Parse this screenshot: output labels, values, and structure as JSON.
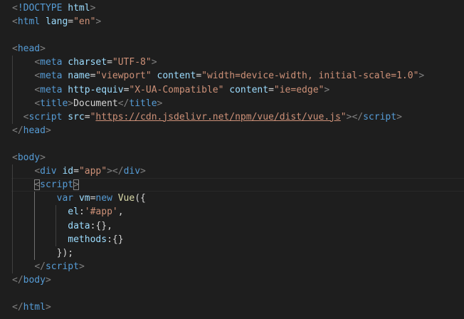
{
  "editor": {
    "lines": [
      [
        {
          "t": "<",
          "c": "punc"
        },
        {
          "t": "!DOCTYPE",
          "c": "tag"
        },
        {
          "t": " ",
          "c": "txt"
        },
        {
          "t": "html",
          "c": "attr"
        },
        {
          "t": ">",
          "c": "punc"
        }
      ],
      [
        {
          "t": "<",
          "c": "punc"
        },
        {
          "t": "html",
          "c": "tag"
        },
        {
          "t": " ",
          "c": "txt"
        },
        {
          "t": "lang",
          "c": "attr"
        },
        {
          "t": "=",
          "c": "txt"
        },
        {
          "t": "\"en\"",
          "c": "str"
        },
        {
          "t": ">",
          "c": "punc"
        }
      ],
      [],
      [
        {
          "t": "<",
          "c": "punc"
        },
        {
          "t": "head",
          "c": "tag"
        },
        {
          "t": ">",
          "c": "punc"
        }
      ],
      [
        {
          "t": "<",
          "c": "punc"
        },
        {
          "t": "meta",
          "c": "tag"
        },
        {
          "t": " ",
          "c": "txt"
        },
        {
          "t": "charset",
          "c": "attr"
        },
        {
          "t": "=",
          "c": "txt"
        },
        {
          "t": "\"UTF-8\"",
          "c": "str"
        },
        {
          "t": ">",
          "c": "punc"
        }
      ],
      [
        {
          "t": "<",
          "c": "punc"
        },
        {
          "t": "meta",
          "c": "tag"
        },
        {
          "t": " ",
          "c": "txt"
        },
        {
          "t": "name",
          "c": "attr"
        },
        {
          "t": "=",
          "c": "txt"
        },
        {
          "t": "\"viewport\"",
          "c": "str"
        },
        {
          "t": " ",
          "c": "txt"
        },
        {
          "t": "content",
          "c": "attr"
        },
        {
          "t": "=",
          "c": "txt"
        },
        {
          "t": "\"width=device-width, initial-scale=1.0\"",
          "c": "str"
        },
        {
          "t": ">",
          "c": "punc"
        }
      ],
      [
        {
          "t": "<",
          "c": "punc"
        },
        {
          "t": "meta",
          "c": "tag"
        },
        {
          "t": " ",
          "c": "txt"
        },
        {
          "t": "http-equiv",
          "c": "attr"
        },
        {
          "t": "=",
          "c": "txt"
        },
        {
          "t": "\"X-UA-Compatible\"",
          "c": "str"
        },
        {
          "t": " ",
          "c": "txt"
        },
        {
          "t": "content",
          "c": "attr"
        },
        {
          "t": "=",
          "c": "txt"
        },
        {
          "t": "\"ie=edge\"",
          "c": "str"
        },
        {
          "t": ">",
          "c": "punc"
        }
      ],
      [
        {
          "t": "<",
          "c": "punc"
        },
        {
          "t": "title",
          "c": "tag"
        },
        {
          "t": ">",
          "c": "punc"
        },
        {
          "t": "Document",
          "c": "txt"
        },
        {
          "t": "</",
          "c": "punc"
        },
        {
          "t": "title",
          "c": "tag"
        },
        {
          "t": ">",
          "c": "punc"
        }
      ],
      [
        {
          "t": "<",
          "c": "punc"
        },
        {
          "t": "script",
          "c": "tag"
        },
        {
          "t": " ",
          "c": "txt"
        },
        {
          "t": "src",
          "c": "attr"
        },
        {
          "t": "=",
          "c": "txt"
        },
        {
          "t": "\"",
          "c": "str"
        },
        {
          "t": "https://cdn.jsdelivr.net/npm/vue/dist/vue.js",
          "c": "str link"
        },
        {
          "t": "\"",
          "c": "str"
        },
        {
          "t": "></",
          "c": "punc"
        },
        {
          "t": "script",
          "c": "tag"
        },
        {
          "t": ">",
          "c": "punc"
        }
      ],
      [
        {
          "t": "</",
          "c": "punc"
        },
        {
          "t": "head",
          "c": "tag"
        },
        {
          "t": ">",
          "c": "punc"
        }
      ],
      [],
      [
        {
          "t": "<",
          "c": "punc"
        },
        {
          "t": "body",
          "c": "tag"
        },
        {
          "t": ">",
          "c": "punc"
        }
      ],
      [
        {
          "t": "<",
          "c": "punc"
        },
        {
          "t": "div",
          "c": "tag"
        },
        {
          "t": " ",
          "c": "txt"
        },
        {
          "t": "id",
          "c": "attr"
        },
        {
          "t": "=",
          "c": "txt"
        },
        {
          "t": "\"app\"",
          "c": "str"
        },
        {
          "t": "></",
          "c": "punc"
        },
        {
          "t": "div",
          "c": "tag"
        },
        {
          "t": ">",
          "c": "punc"
        }
      ],
      [
        {
          "t": "<",
          "c": "punc bracket-match"
        },
        {
          "t": "script",
          "c": "tag"
        },
        {
          "t": ">",
          "c": "punc bracket-match"
        }
      ],
      [
        {
          "t": "var",
          "c": "kw"
        },
        {
          "t": " ",
          "c": "txt"
        },
        {
          "t": "vm",
          "c": "var"
        },
        {
          "t": "=",
          "c": "txt"
        },
        {
          "t": "new",
          "c": "kw"
        },
        {
          "t": " ",
          "c": "txt"
        },
        {
          "t": "Vue",
          "c": "fn"
        },
        {
          "t": "({",
          "c": "txt"
        }
      ],
      [
        {
          "t": "el",
          "c": "var"
        },
        {
          "t": ":",
          "c": "txt"
        },
        {
          "t": "'#app'",
          "c": "str"
        },
        {
          "t": ",",
          "c": "txt"
        }
      ],
      [
        {
          "t": "data",
          "c": "var"
        },
        {
          "t": ":{},",
          "c": "txt"
        }
      ],
      [
        {
          "t": "methods",
          "c": "var"
        },
        {
          "t": ":{}",
          "c": "txt"
        }
      ],
      [
        {
          "t": "});",
          "c": "txt"
        }
      ],
      [
        {
          "t": "</",
          "c": "punc"
        },
        {
          "t": "script",
          "c": "tag"
        },
        {
          "t": ">",
          "c": "punc"
        }
      ],
      [
        {
          "t": "</",
          "c": "punc"
        },
        {
          "t": "body",
          "c": "tag"
        },
        {
          "t": ">",
          "c": "punc"
        }
      ],
      [],
      [
        {
          "t": "</",
          "c": "punc"
        },
        {
          "t": "html",
          "c": "tag"
        },
        {
          "t": ">",
          "c": "punc"
        }
      ]
    ]
  }
}
